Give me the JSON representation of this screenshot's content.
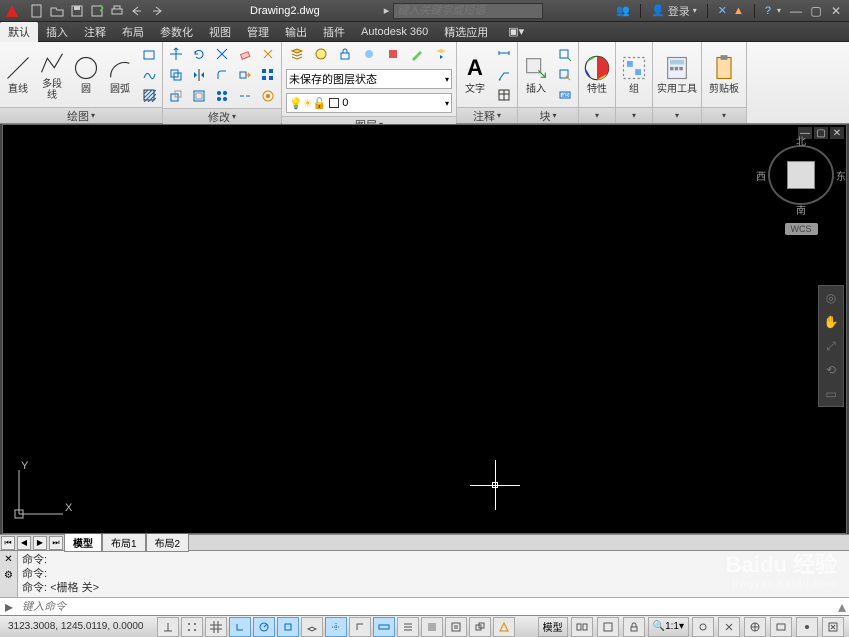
{
  "title": "Drawing2.dwg",
  "search_placeholder": "键入关键字或短语",
  "login_label": "登录",
  "menu": {
    "items": [
      "默认",
      "插入",
      "注释",
      "布局",
      "参数化",
      "视图",
      "管理",
      "输出",
      "插件",
      "Autodesk 360",
      "精选应用"
    ],
    "active": 0
  },
  "ribbon": {
    "panels": {
      "draw": {
        "title": "绘图",
        "btns": [
          "直线",
          "多段线",
          "圆",
          "圆弧"
        ]
      },
      "modify": {
        "title": "修改"
      },
      "layer": {
        "title": "图层",
        "combo1": "未保存的图层状态",
        "combo2_layer": "0"
      },
      "annot": {
        "title": "注释",
        "text_btn": "文字"
      },
      "block": {
        "title": "块",
        "insert_btn": "插入"
      },
      "props": {
        "title": "特性"
      },
      "group": {
        "title": "组"
      },
      "util": {
        "title": "实用工具"
      },
      "clip": {
        "title": "剪贴板"
      }
    }
  },
  "viewcube": {
    "n": "北",
    "s": "南",
    "e": "东",
    "w": "西",
    "wcs": "WCS"
  },
  "tabs": {
    "items": [
      "模型",
      "布局1",
      "布局2"
    ],
    "active": 0
  },
  "cmd": {
    "history": [
      "命令:",
      "命令:",
      "命令:  <栅格 关>"
    ],
    "prompt": "▸",
    "placeholder": "键入命令"
  },
  "status": {
    "coords": "3123.3008, 1245.0119, 0.0000",
    "model": "模型",
    "scale": "1:1"
  },
  "ucs": {
    "x": "X",
    "y": "Y"
  },
  "watermark": {
    "main": "Baidu 经验",
    "sub": "jingyan.baidu.com"
  }
}
